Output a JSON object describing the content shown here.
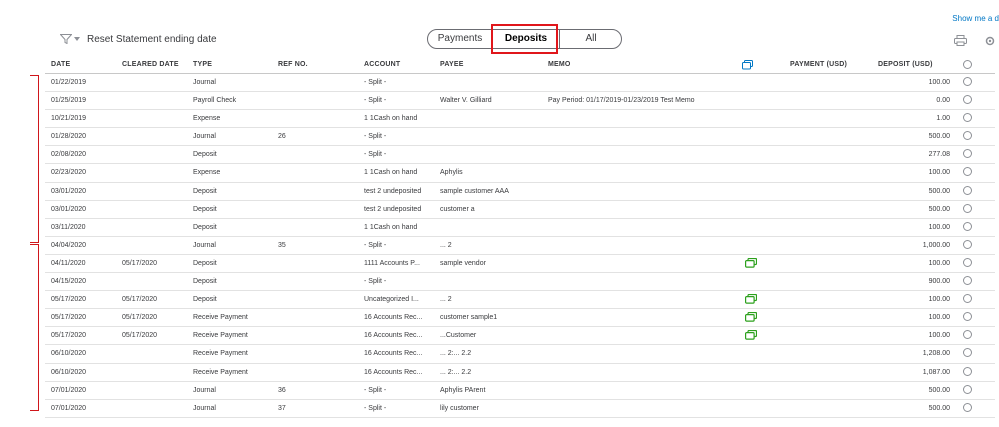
{
  "top_link": "Show me a d",
  "toolbar": {
    "reset_label": "Reset Statement ending date"
  },
  "tabs": [
    {
      "label": "Payments",
      "active": false
    },
    {
      "label": "Deposits",
      "active": true
    },
    {
      "label": "All",
      "active": false
    }
  ],
  "columns": {
    "date": "DATE",
    "cleared_date": "CLEARED DATE",
    "type": "TYPE",
    "ref_no": "REF NO.",
    "account": "ACCOUNT",
    "payee": "PAYEE",
    "memo": "MEMO",
    "payment": "PAYMENT (USD)",
    "deposit": "DEPOSIT (USD)"
  },
  "rows": [
    {
      "date": "01/22/2019",
      "cleared": "",
      "type": "Journal",
      "ref": "",
      "account": "- Split -",
      "payee": "",
      "memo": "",
      "attach": false,
      "payment": "",
      "deposit": "100.00"
    },
    {
      "date": "01/25/2019",
      "cleared": "",
      "type": "Payroll Check",
      "ref": "",
      "account": "- Split -",
      "payee": "Walter V. Gilliard",
      "memo": "Pay Period: 01/17/2019-01/23/2019 Test Memo",
      "attach": false,
      "payment": "",
      "deposit": "0.00"
    },
    {
      "date": "10/21/2019",
      "cleared": "",
      "type": "Expense",
      "ref": "",
      "account": "1 1Cash on hand",
      "payee": "",
      "memo": "",
      "attach": false,
      "payment": "",
      "deposit": "1.00"
    },
    {
      "date": "01/28/2020",
      "cleared": "",
      "type": "Journal",
      "ref": "26",
      "account": "- Split -",
      "payee": "",
      "memo": "",
      "attach": false,
      "payment": "",
      "deposit": "500.00"
    },
    {
      "date": "02/08/2020",
      "cleared": "",
      "type": "Deposit",
      "ref": "",
      "account": "- Split -",
      "payee": "",
      "memo": "",
      "attach": false,
      "payment": "",
      "deposit": "277.08"
    },
    {
      "date": "02/23/2020",
      "cleared": "",
      "type": "Expense",
      "ref": "",
      "account": "1 1Cash on hand",
      "payee": "Aphylis",
      "memo": "",
      "attach": false,
      "payment": "",
      "deposit": "100.00"
    },
    {
      "date": "03/01/2020",
      "cleared": "",
      "type": "Deposit",
      "ref": "",
      "account": "test 2 undeposited",
      "payee": "sample customer AAA",
      "memo": "",
      "attach": false,
      "payment": "",
      "deposit": "500.00"
    },
    {
      "date": "03/01/2020",
      "cleared": "",
      "type": "Deposit",
      "ref": "",
      "account": "test 2 undeposited",
      "payee": "customer a",
      "memo": "",
      "attach": false,
      "payment": "",
      "deposit": "500.00"
    },
    {
      "date": "03/11/2020",
      "cleared": "",
      "type": "Deposit",
      "ref": "",
      "account": "1 1Cash on hand",
      "payee": "",
      "memo": "",
      "attach": false,
      "payment": "",
      "deposit": "100.00"
    },
    {
      "date": "04/04/2020",
      "cleared": "",
      "type": "Journal",
      "ref": "35",
      "account": "- Split -",
      "payee": "... 2",
      "memo": "",
      "attach": false,
      "payment": "",
      "deposit": "1,000.00"
    },
    {
      "date": "04/11/2020",
      "cleared": "05/17/2020",
      "type": "Deposit",
      "ref": "",
      "account": "1111 Accounts P...",
      "payee": "sample vendor",
      "memo": "",
      "attach": true,
      "payment": "",
      "deposit": "100.00"
    },
    {
      "date": "04/15/2020",
      "cleared": "",
      "type": "Deposit",
      "ref": "",
      "account": "- Split -",
      "payee": "",
      "memo": "",
      "attach": false,
      "payment": "",
      "deposit": "900.00"
    },
    {
      "date": "05/17/2020",
      "cleared": "05/17/2020",
      "type": "Deposit",
      "ref": "",
      "account": "Uncategorized I...",
      "payee": "... 2",
      "memo": "",
      "attach": true,
      "payment": "",
      "deposit": "100.00"
    },
    {
      "date": "05/17/2020",
      "cleared": "05/17/2020",
      "type": "Receive Payment",
      "ref": "",
      "account": "16 Accounts Rec...",
      "payee": "customer sample1",
      "memo": "",
      "attach": true,
      "payment": "",
      "deposit": "100.00"
    },
    {
      "date": "05/17/2020",
      "cleared": "05/17/2020",
      "type": "Receive Payment",
      "ref": "",
      "account": "16 Accounts Rec...",
      "payee": "...Customer",
      "memo": "",
      "attach": true,
      "payment": "",
      "deposit": "100.00"
    },
    {
      "date": "06/10/2020",
      "cleared": "",
      "type": "Receive Payment",
      "ref": "",
      "account": "16 Accounts Rec...",
      "payee": "... 2:... 2.2",
      "memo": "",
      "attach": false,
      "payment": "",
      "deposit": "1,208.00"
    },
    {
      "date": "06/10/2020",
      "cleared": "",
      "type": "Receive Payment",
      "ref": "",
      "account": "16 Accounts Rec...",
      "payee": "... 2:... 2.2",
      "memo": "",
      "attach": false,
      "payment": "",
      "deposit": "1,087.00"
    },
    {
      "date": "07/01/2020",
      "cleared": "",
      "type": "Journal",
      "ref": "36",
      "account": "- Split -",
      "payee": "Aphylis PArent",
      "memo": "",
      "attach": false,
      "payment": "",
      "deposit": "500.00"
    },
    {
      "date": "07/01/2020",
      "cleared": "",
      "type": "Journal",
      "ref": "37",
      "account": "- Split -",
      "payee": "lily customer",
      "memo": "",
      "attach": false,
      "payment": "",
      "deposit": "500.00"
    }
  ],
  "colors": {
    "accent_red": "#e0161b",
    "attach_green": "#2ca01c",
    "link_blue": "#0077c5"
  },
  "icons": [
    "filter-icon",
    "chevron-down-icon",
    "print-icon",
    "gear-icon",
    "copy-icon",
    "radio-icon"
  ]
}
